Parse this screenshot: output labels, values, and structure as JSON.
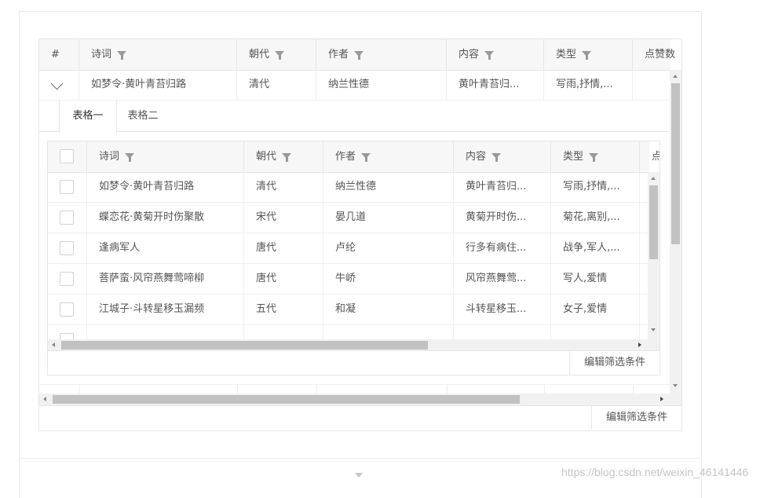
{
  "outer_table": {
    "columns": [
      "#",
      "诗词",
      "朝代",
      "作者",
      "内容",
      "类型",
      "点赞数"
    ],
    "expanded_row": {
      "poem": "如梦令·黄叶青苔归路",
      "dynasty": "清代",
      "author": "纳兰性德",
      "content": "黄叶青苔归...",
      "type": "写雨,抒情,..."
    },
    "filter_button": "编辑筛选条件"
  },
  "tabs": [
    "表格一",
    "表格二"
  ],
  "inner_table": {
    "columns": [
      "诗词",
      "朝代",
      "作者",
      "内容",
      "类型",
      "点"
    ],
    "rows": [
      {
        "poem": "如梦令·黄叶青苔归路",
        "dynasty": "清代",
        "author": "纳兰性德",
        "content": "黄叶青苔归...",
        "type": "写雨,抒情,..."
      },
      {
        "poem": "蝶恋花·黄菊开时伤聚散",
        "dynasty": "宋代",
        "author": "晏几道",
        "content": "黄菊开时伤...",
        "type": "菊花,离别,..."
      },
      {
        "poem": "逢病军人",
        "dynasty": "唐代",
        "author": "卢纶",
        "content": "行多有病住...",
        "type": "战争,军人,..."
      },
      {
        "poem": "菩萨蛮·风帘燕舞莺啼柳",
        "dynasty": "唐代",
        "author": "牛峤",
        "content": "风帘燕舞莺...",
        "type": "写人,爱情"
      },
      {
        "poem": "江城子·斗转星移玉漏频",
        "dynasty": "五代",
        "author": "和凝",
        "content": "斗转星移玉...",
        "type": "女子,爱情"
      }
    ],
    "filter_button": "编辑筛选条件"
  },
  "watermark": "https://blog.csdn.net/weixin_46141446"
}
